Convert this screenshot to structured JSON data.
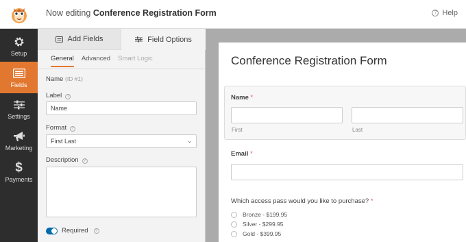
{
  "header": {
    "prefix": "Now editing",
    "form_name": "Conference Registration Form",
    "help_label": "Help"
  },
  "sidebar": {
    "items": [
      {
        "label": "Setup",
        "icon": "gear-icon"
      },
      {
        "label": "Fields",
        "icon": "fields-icon",
        "active": true
      },
      {
        "label": "Settings",
        "icon": "sliders-icon"
      },
      {
        "label": "Marketing",
        "icon": "megaphone-icon"
      },
      {
        "label": "Payments",
        "icon": "dollar-icon"
      }
    ]
  },
  "panel": {
    "tabs": {
      "add_fields": "Add Fields",
      "field_options": "Field Options"
    },
    "subtabs": {
      "general": "General",
      "advanced": "Advanced",
      "smart_logic": "Smart Logic"
    },
    "field_name": "Name",
    "field_id": "(ID #1)",
    "label_label": "Label",
    "label_value": "Name",
    "format_label": "Format",
    "format_value": "First Last",
    "description_label": "Description",
    "description_value": "",
    "required_label": "Required",
    "required_on": true
  },
  "preview": {
    "title": "Conference Registration Form",
    "name_label": "Name",
    "first_label": "First",
    "last_label": "Last",
    "email_label": "Email",
    "question": "Which access pass would you like to purchase?",
    "options": [
      "Bronze - $199.95",
      "Silver - $299.95",
      "Gold - $399.95"
    ],
    "required_mark": "*"
  },
  "colors": {
    "accent": "#e27730",
    "sidebar_bg": "#2d2d2d",
    "toggle": "#036aab",
    "required": "#e25c5c"
  }
}
